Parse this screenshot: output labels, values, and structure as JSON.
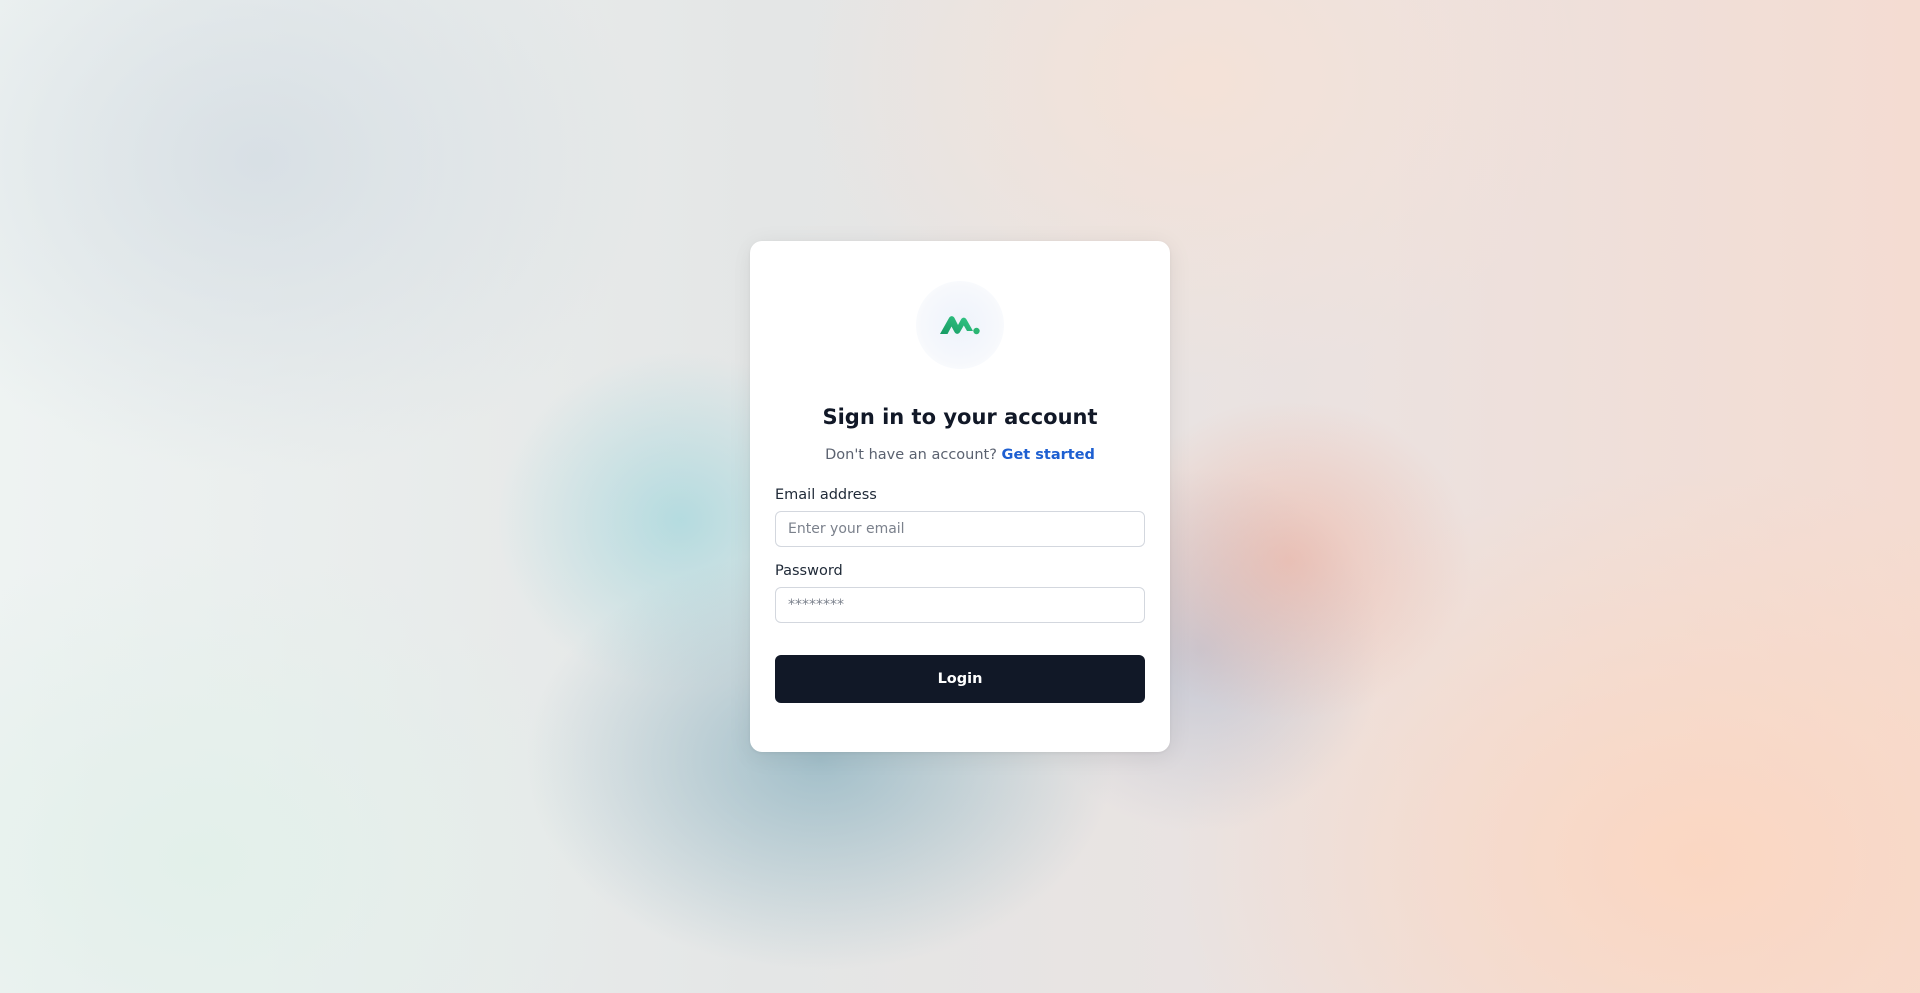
{
  "colors": {
    "brand_green": "#2bb673",
    "link_blue": "#1d5fd1",
    "button_bg": "#111827"
  },
  "logo": {
    "icon": "brand-logo-icon"
  },
  "login_card": {
    "title": "Sign in to your account",
    "signup_prompt": "Don't have an account?",
    "signup_link": "Get started",
    "email": {
      "label": "Email address",
      "placeholder": "Enter your email",
      "value": ""
    },
    "password": {
      "label": "Password",
      "placeholder": "********",
      "value": ""
    },
    "submit_label": "Login"
  }
}
